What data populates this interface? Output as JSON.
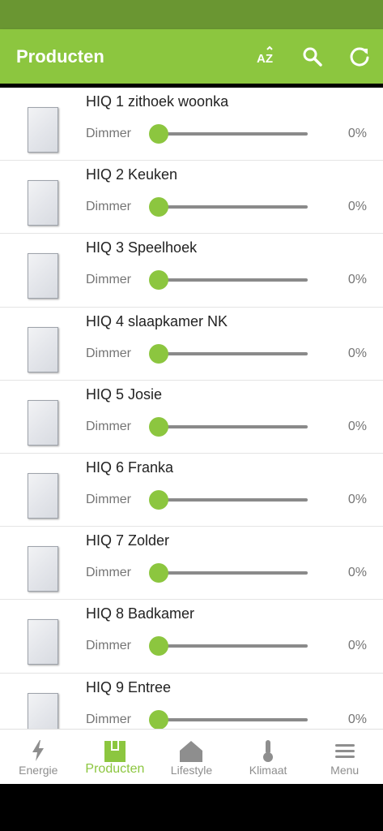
{
  "app": {
    "title": "Producten",
    "actions": [
      {
        "name": "sort-az-icon",
        "label": "AZ"
      },
      {
        "name": "search-icon"
      },
      {
        "name": "refresh-icon"
      }
    ]
  },
  "products": [
    {
      "title": "HIQ 1 zithoek woonka",
      "control_label": "Dimmer",
      "value": "0%",
      "level": 0
    },
    {
      "title": "HIQ 2 Keuken",
      "control_label": "Dimmer",
      "value": "0%",
      "level": 0
    },
    {
      "title": "HIQ 3 Speelhoek",
      "control_label": "Dimmer",
      "value": "0%",
      "level": 0
    },
    {
      "title": "HIQ 4 slaapkamer NK",
      "control_label": "Dimmer",
      "value": "0%",
      "level": 0
    },
    {
      "title": "HIQ 5 Josie",
      "control_label": "Dimmer",
      "value": "0%",
      "level": 0
    },
    {
      "title": "HIQ 6 Franka",
      "control_label": "Dimmer",
      "value": "0%",
      "level": 0
    },
    {
      "title": "HIQ 7 Zolder",
      "control_label": "Dimmer",
      "value": "0%",
      "level": 0
    },
    {
      "title": "HIQ 8 Badkamer",
      "control_label": "Dimmer",
      "value": "0%",
      "level": 0
    },
    {
      "title": "HIQ 9 Entree",
      "control_label": "Dimmer",
      "value": "0%",
      "level": 0
    }
  ],
  "bottom_nav": [
    {
      "label": "Energie",
      "icon": "lightning-icon",
      "active": false
    },
    {
      "label": "Producten",
      "icon": "products-icon",
      "active": true
    },
    {
      "label": "Lifestyle",
      "icon": "home-icon",
      "active": false
    },
    {
      "label": "Klimaat",
      "icon": "thermometer-icon",
      "active": false
    },
    {
      "label": "Menu",
      "icon": "menu-icon",
      "active": false
    }
  ],
  "colors": {
    "accent": "#8cc63f",
    "status_bar": "#6a9632",
    "inactive": "#8e8e8e"
  }
}
